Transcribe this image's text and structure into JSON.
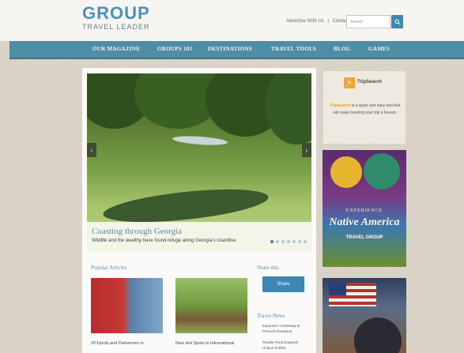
{
  "header": {
    "logo_main": "GROUP",
    "logo_sub": "TRAVEL LEADER",
    "toplinks": [
      "Advertise With Us",
      "|",
      "Contact"
    ],
    "search_placeholder": "Search"
  },
  "nav": {
    "items": [
      "OUR MAGAZINE",
      "GROUPS 101",
      "DESTINATIONS",
      "TRAVEL TOOLS",
      "BLOG",
      "GAMES"
    ]
  },
  "hero": {
    "title": "Coasting through Georgia",
    "text": "Wildlife and the wealthy have found refuge along Georgia's coastline.",
    "prev": "‹",
    "next": "›"
  },
  "popular": {
    "title": "Popular Articles",
    "articles": [
      {
        "title": "Of Fjords and Fishermen in"
      },
      {
        "title": "New Hot Spots in Intrenational"
      }
    ]
  },
  "share": {
    "title": "Share this",
    "button": "Share"
  },
  "travel_news": {
    "title": "Travel News",
    "items": [
      "Expansion Underway at",
      "Pinnock Plantation",
      "Parade Pond Expands",
      "Unique Exhibit"
    ]
  },
  "sidebar": {
    "trip_name": "TripSearch",
    "trip_text_bold": "TripSearch",
    "trip_text": "is a quick and easy tool that will make booking your trip a breeze.",
    "ad1_line1": "EXPERIENCE",
    "ad1_line2": "Native America",
    "ad1_line3": "TRAVEL GROUP"
  },
  "colors": {
    "accent": "#4f8da5",
    "link": "#5d8ab0",
    "button": "#3f86b4"
  }
}
